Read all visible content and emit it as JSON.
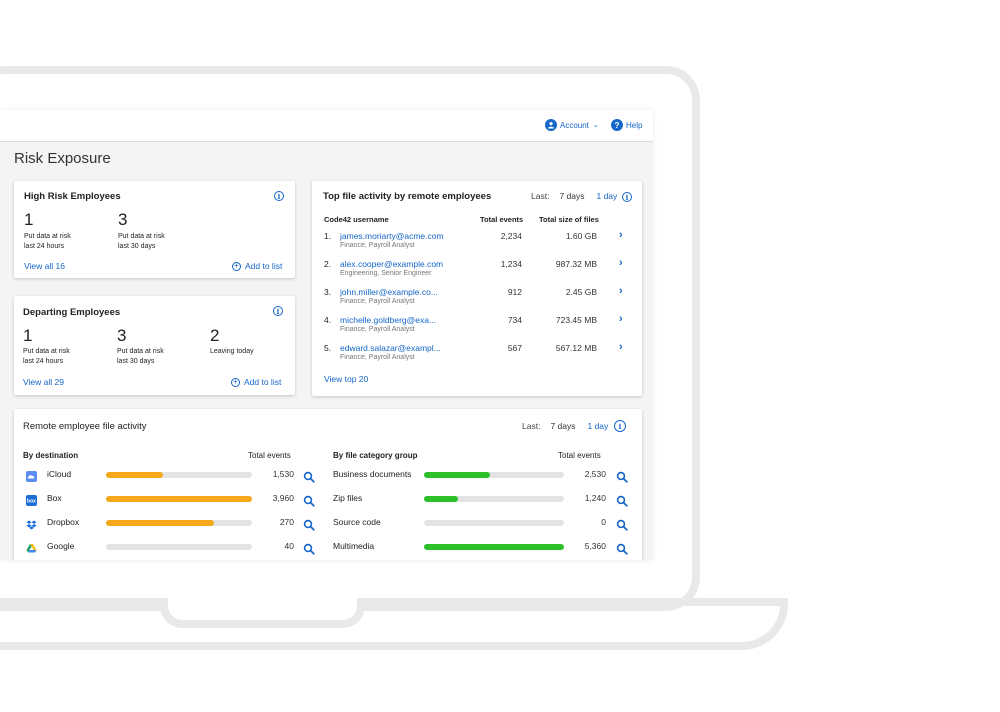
{
  "header": {
    "account_label": "Account",
    "help_label": "Help",
    "account_icon": "user-icon",
    "help_icon": "help-icon"
  },
  "page": {
    "title": "Risk Exposure"
  },
  "high_risk": {
    "title": "High Risk Employees",
    "stats": [
      {
        "value": "1",
        "label_line1": "Put data at risk",
        "label_line2": "last 24 hours"
      },
      {
        "value": "3",
        "label_line1": "Put data at risk",
        "label_line2": "last 30 days"
      }
    ],
    "view_all": "View all 16",
    "add_to_list": "Add to list"
  },
  "departing": {
    "title": "Departing Employees",
    "stats": [
      {
        "value": "1",
        "label_line1": "Put data at risk",
        "label_line2": "last 24 hours"
      },
      {
        "value": "3",
        "label_line1": "Put data at risk",
        "label_line2": "last 30 days"
      },
      {
        "value": "2",
        "label_line1": "Leaving today",
        "label_line2": ""
      }
    ],
    "view_all": "View all 29",
    "add_to_list": "Add to list"
  },
  "top_activity": {
    "title": "Top file activity by remote employees",
    "filter": {
      "last_label": "Last:",
      "option_7": "7 days",
      "option_1": "1 day",
      "selected": "1 day"
    },
    "columns": {
      "username": "Code42 username",
      "events": "Total events",
      "size": "Total size of files"
    },
    "rows": [
      {
        "num": "1.",
        "email": "james.moriarty@acme.com",
        "role": "Finance, Payroll Analyst",
        "events": "2,234",
        "size": "1.60 GB"
      },
      {
        "num": "2.",
        "email": "alex.cooper@example.com",
        "role": "Engineering, Senior Engineer",
        "events": "1,234",
        "size": "987.32 MB"
      },
      {
        "num": "3.",
        "email": "john.miller@example.co...",
        "role": "Finance, Payroll Analyst",
        "events": "912",
        "size": "2.45 GB"
      },
      {
        "num": "4.",
        "email": "michelle.goldberg@exa...",
        "role": "Finance, Payroll Analyst",
        "events": "734",
        "size": "723.45 MB"
      },
      {
        "num": "5.",
        "email": "edward.salazar@exampl...",
        "role": "Finance, Payroll Analyst",
        "events": "567",
        "size": "567.12 MB"
      }
    ],
    "view_top": "View top 20"
  },
  "remote_activity": {
    "title": "Remote employee file activity",
    "filter": {
      "last_label": "Last:",
      "option_7": "7 days",
      "option_1": "1 day",
      "selected": "1 day"
    },
    "destination": {
      "heading": "By destination",
      "events_heading": "Total events",
      "bar_color": "#f5a81c",
      "rows": [
        {
          "label": "iCloud",
          "icon": "icloud-icon",
          "value": "1,530",
          "fill": 0.39
        },
        {
          "label": "Box",
          "icon": "box-icon",
          "value": "3,960",
          "fill": 1.0
        },
        {
          "label": "Dropbox",
          "icon": "dropbox-icon",
          "value": "270",
          "fill": 0.74
        },
        {
          "label": "Google",
          "icon": "google-drive-icon",
          "value": "40",
          "fill": 0.0
        }
      ]
    },
    "category": {
      "heading": "By file category group",
      "events_heading": "Total events",
      "bar_color": "#2ec02b",
      "rows": [
        {
          "label": "Business documents",
          "value": "2,530",
          "fill": 0.47
        },
        {
          "label": "Zip files",
          "value": "1,240",
          "fill": 0.24
        },
        {
          "label": "Source code",
          "value": "0",
          "fill": 0.0
        },
        {
          "label": "Multimedia",
          "value": "5,360",
          "fill": 1.0
        }
      ]
    }
  }
}
